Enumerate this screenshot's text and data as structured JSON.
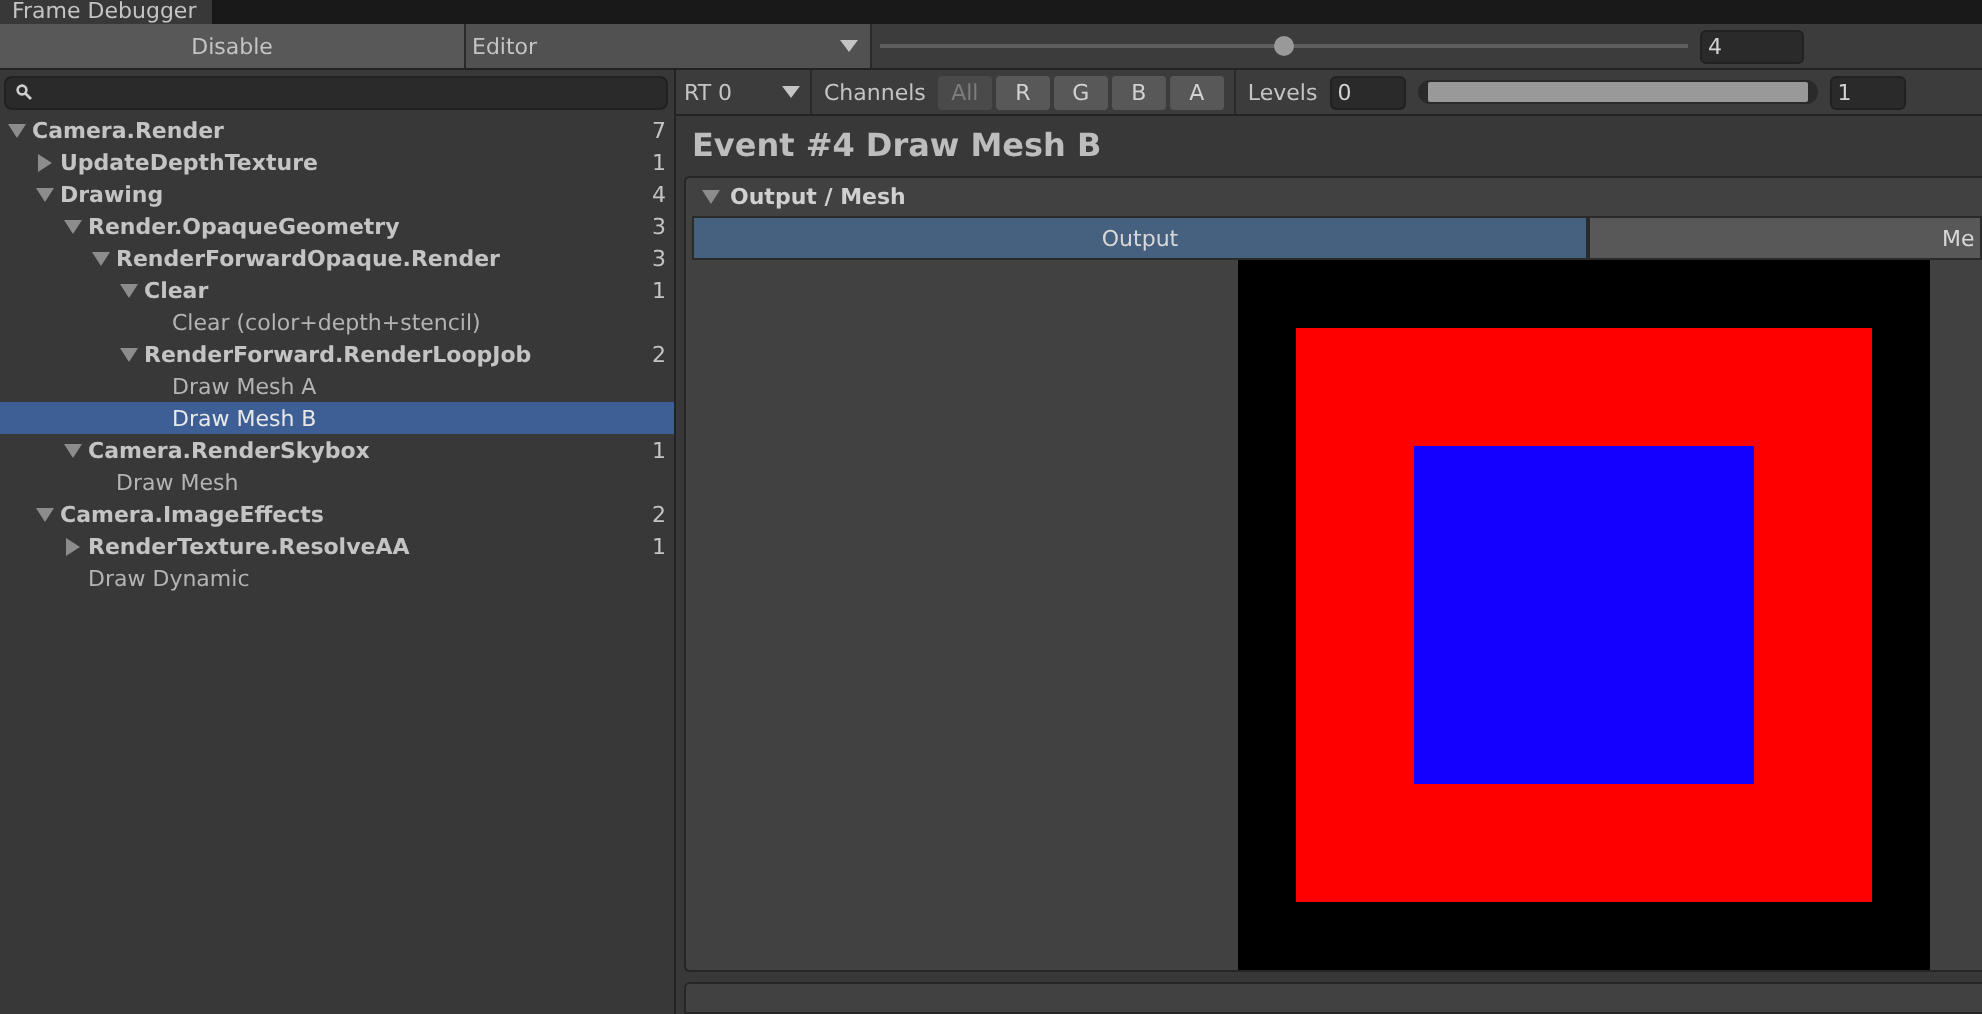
{
  "window": {
    "title": "Frame Debugger"
  },
  "toolbar": {
    "toggle_button": "Disable",
    "target_dropdown": "Editor",
    "event_slider": {
      "level": 0.5
    },
    "event_field": "4"
  },
  "tree": [
    {
      "label": "Camera.Render",
      "count": "7",
      "expanded": true,
      "selected": false,
      "children": [
        {
          "label": "UpdateDepthTexture",
          "count": "1",
          "expanded": false,
          "selected": false
        },
        {
          "label": "Drawing",
          "count": "4",
          "expanded": true,
          "selected": false,
          "children": [
            {
              "label": "Render.OpaqueGeometry",
              "count": "3",
              "expanded": true,
              "selected": false,
              "children": [
                {
                  "label": "RenderForwardOpaque.Render",
                  "count": "3",
                  "expanded": true,
                  "selected": false,
                  "children": [
                    {
                      "label": "Clear",
                      "count": "1",
                      "expanded": true,
                      "selected": false,
                      "children": [
                        {
                          "label": "Clear (color+depth+stencil)",
                          "selected": false
                        }
                      ]
                    },
                    {
                      "label": "RenderForward.RenderLoopJob",
                      "count": "2",
                      "expanded": true,
                      "selected": false,
                      "children": [
                        {
                          "label": "Draw Mesh A",
                          "selected": false
                        },
                        {
                          "label": "Draw Mesh B",
                          "selected": true
                        }
                      ]
                    }
                  ]
                }
              ]
            },
            {
              "label": "Camera.RenderSkybox",
              "count": "1",
              "expanded": true,
              "selected": false,
              "children": [
                {
                  "label": "Draw Mesh",
                  "selected": false
                }
              ]
            }
          ]
        },
        {
          "label": "Camera.ImageEffects",
          "count": "2",
          "expanded": true,
          "selected": false,
          "children": [
            {
              "label": "RenderTexture.ResolveAA",
              "count": "1",
              "expanded": false,
              "selected": false
            },
            {
              "label": "Draw Dynamic",
              "selected": false
            }
          ]
        }
      ]
    }
  ],
  "view_bar": {
    "render_target": "RT 0",
    "channels_label": "Channels",
    "channels": [
      {
        "label": "All",
        "selected": false
      },
      {
        "label": "R",
        "selected": true
      },
      {
        "label": "G",
        "selected": true
      },
      {
        "label": "B",
        "selected": true
      },
      {
        "label": "A",
        "selected": true
      }
    ],
    "levels_label": "Levels",
    "levels_min": "0",
    "levels_slider": {
      "level": 1
    },
    "levels_max": "1"
  },
  "event_title": "Event #4 Draw Mesh B",
  "section": {
    "title": "Output / Mesh",
    "expanded": true,
    "tabs": [
      {
        "label": "Output",
        "selected": true
      },
      {
        "label": "Me",
        "selected": false
      }
    ]
  }
}
